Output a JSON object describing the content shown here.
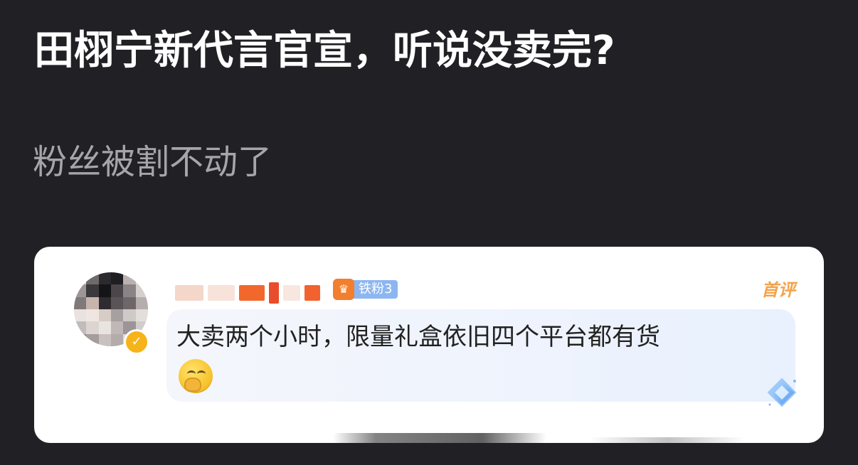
{
  "post": {
    "title": "田栩宁新代言官宣，听说没卖完?",
    "subtitle": "粉丝被割不动了"
  },
  "comment": {
    "username_masked": true,
    "avatar_masked": true,
    "fan_badge": {
      "icon": "fan-level-icon",
      "label": "铁粉3"
    },
    "top_tag": "首评",
    "text": "大卖两个小时，限量礼盒依旧四个平台都有货",
    "emoji": "covering-mouth-emoji",
    "verified_icon": "verified-v-badge"
  },
  "colors": {
    "background": "#212025",
    "title": "#ffffff",
    "subtitle": "#a6a6aa",
    "card": "#ffffff",
    "fan_badge": "#8cb6f1",
    "top_tag": "#f2a34b",
    "verified": "#f6b41a"
  }
}
